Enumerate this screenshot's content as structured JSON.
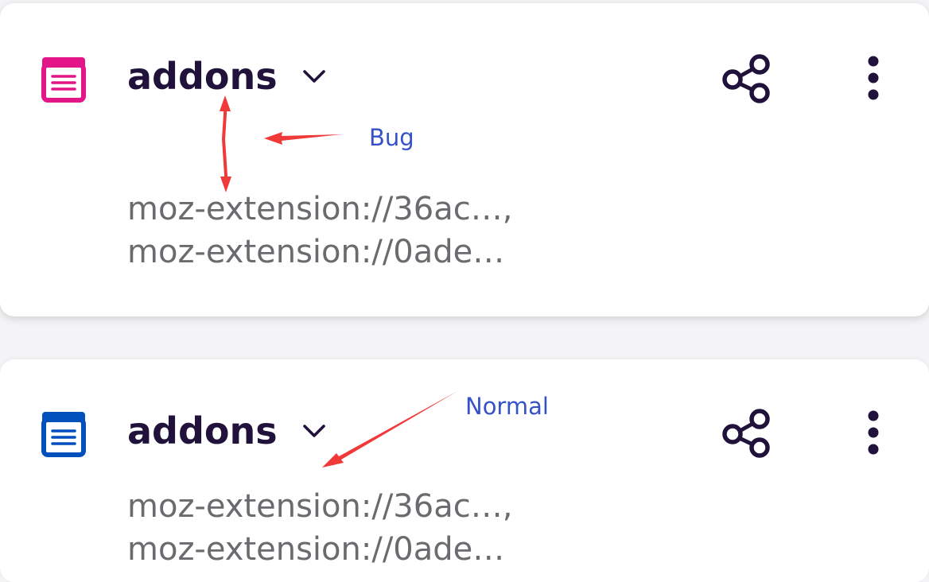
{
  "cards": [
    {
      "title": "addons",
      "url_line_1": "moz-extension://36ac…,",
      "url_line_2": "moz-extension://0ade…",
      "icon": "collection-icon",
      "icon_color": "#e31587"
    },
    {
      "title": "addons",
      "url_line_1": "moz-extension://36ac…,",
      "url_line_2": "moz-extension://0ade…",
      "icon": "collection-icon",
      "icon_color": "#0250bb"
    }
  ],
  "annotations": {
    "bug_label": "Bug",
    "normal_label": "Normal",
    "arrow_color": "#f03a3a"
  },
  "colors": {
    "title_text": "#20123a",
    "url_text": "#6b6b6f",
    "annotation_text": "#3552c8"
  }
}
